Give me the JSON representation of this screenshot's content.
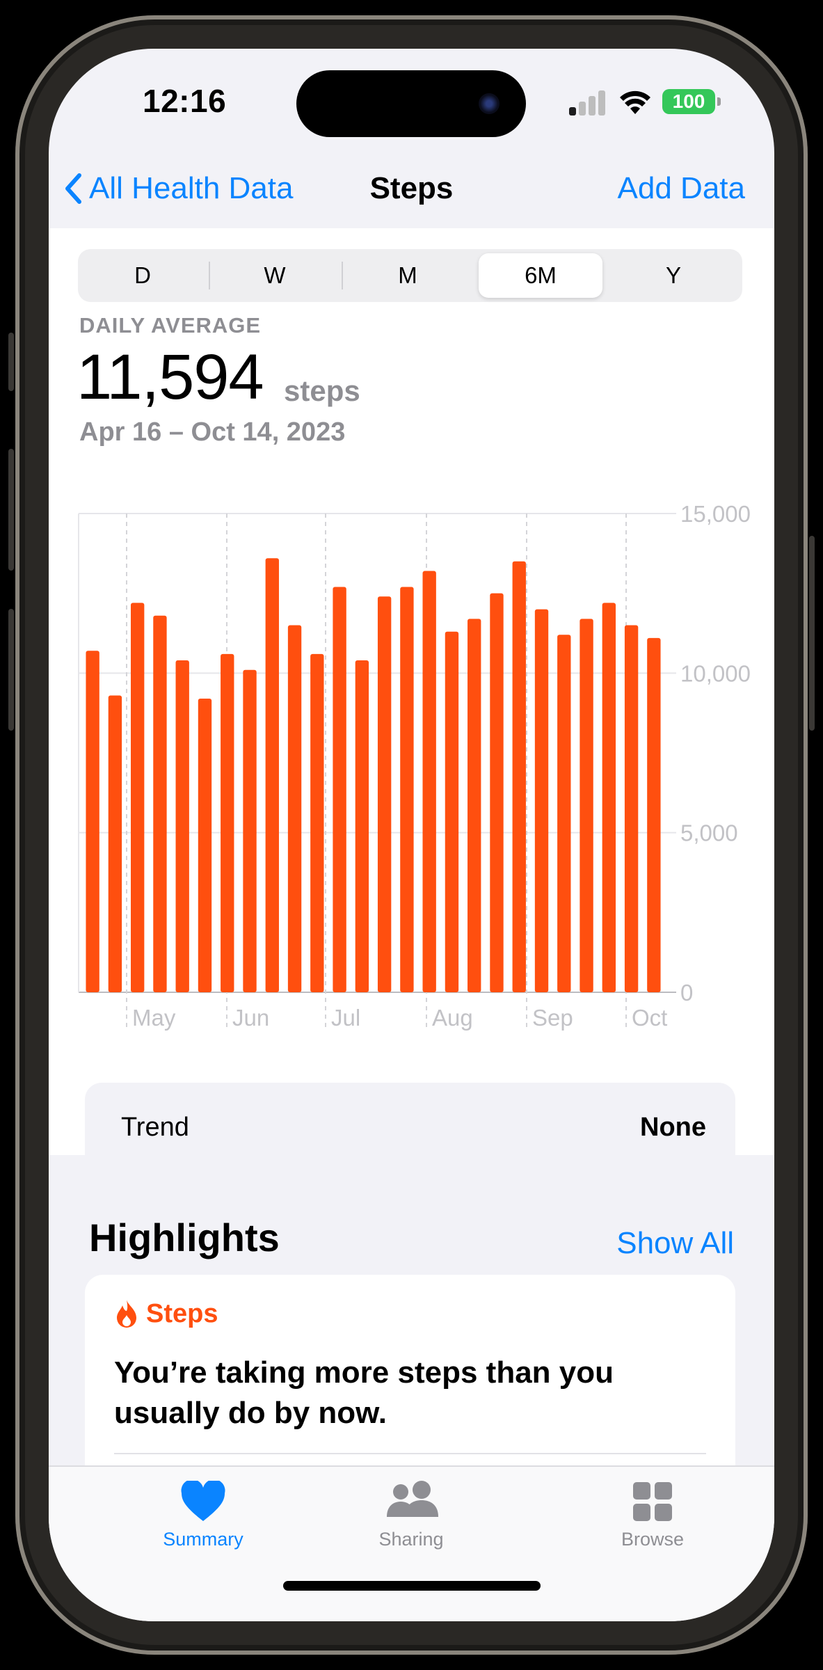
{
  "status_bar": {
    "time": "12:16",
    "battery": "100"
  },
  "nav": {
    "back_label": "All Health Data",
    "title": "Steps",
    "action_label": "Add Data"
  },
  "segments": {
    "items": [
      "D",
      "W",
      "M",
      "6M",
      "Y"
    ],
    "selected": "6M"
  },
  "summary": {
    "label": "DAILY AVERAGE",
    "value": "11,594",
    "unit": "steps",
    "date_range": "Apr 16 – Oct 14, 2023"
  },
  "chart_data": {
    "type": "bar",
    "x_tick_labels": [
      "May",
      "Jun",
      "Jul",
      "Aug",
      "Sep",
      "Oct"
    ],
    "y_tick_labels": [
      "15,000",
      "10,000",
      "5,000",
      "0"
    ],
    "ylim": [
      0,
      15000
    ],
    "yticks": [
      15000,
      10000,
      5000,
      0
    ],
    "values": [
      10700,
      9300,
      12200,
      11800,
      10400,
      9200,
      10600,
      10100,
      13600,
      11500,
      10600,
      12700,
      10400,
      12400,
      12700,
      13200,
      11300,
      11700,
      12500,
      13500,
      12000,
      11200,
      11700,
      12200,
      11500,
      11100
    ],
    "bar_color": "#ff4f0f",
    "grid": true
  },
  "trend": {
    "label": "Trend",
    "value": "None"
  },
  "highlights": {
    "title": "Highlights",
    "show_all_label": "Show All",
    "card": {
      "category": "Steps",
      "text": "You’re taking more steps than you usually do by now."
    }
  },
  "tab_bar": {
    "tabs": [
      {
        "label": "Summary",
        "icon": "heart-icon",
        "active": true
      },
      {
        "label": "Sharing",
        "icon": "people-icon",
        "active": false
      },
      {
        "label": "Browse",
        "icon": "grid-icon",
        "active": false
      }
    ]
  },
  "colors": {
    "accent": "#0a84ff",
    "steps": "#ff4f0f",
    "battery": "#34c759"
  }
}
